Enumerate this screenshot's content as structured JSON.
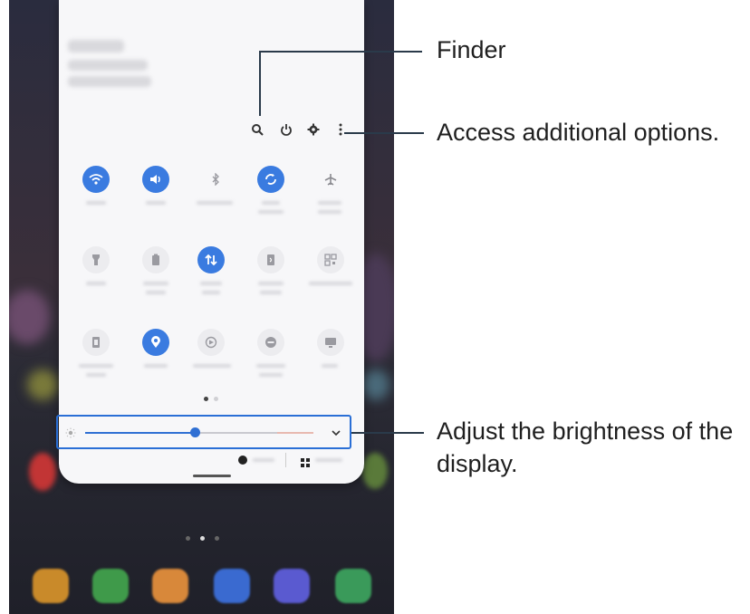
{
  "callouts": {
    "finder": "Finder",
    "options": "Access additional options.",
    "brightness_line1": "Adjust the brightness of the",
    "brightness_line2": "display."
  },
  "header_icons": [
    "search-icon",
    "power-icon",
    "settings-icon",
    "more-options-icon"
  ],
  "quick_tiles_rows": [
    [
      {
        "icon": "wifi-icon",
        "on": true
      },
      {
        "icon": "sound-icon",
        "on": true
      },
      {
        "icon": "bluetooth-icon",
        "on": false
      },
      {
        "icon": "auto-rotate-icon",
        "on": true
      },
      {
        "icon": "airplane-mode-icon",
        "on": false
      }
    ],
    [
      {
        "icon": "flashlight-icon",
        "on": false
      },
      {
        "icon": "power-mode-icon",
        "on": false
      },
      {
        "icon": "mobile-data-icon",
        "on": true
      },
      {
        "icon": "nfc-icon",
        "on": false
      },
      {
        "icon": "qr-scanner-icon",
        "on": false
      }
    ],
    [
      {
        "icon": "battery-saver-icon",
        "on": false
      },
      {
        "icon": "location-icon",
        "on": true
      },
      {
        "icon": "screen-recorder-icon",
        "on": false
      },
      {
        "icon": "do-not-disturb-icon",
        "on": false
      },
      {
        "icon": "dex-icon",
        "on": false
      }
    ]
  ],
  "brightness": {
    "level": 0.45
  },
  "colors": {
    "accent": "#3a7be0",
    "callout_line": "#2a3a4a"
  }
}
